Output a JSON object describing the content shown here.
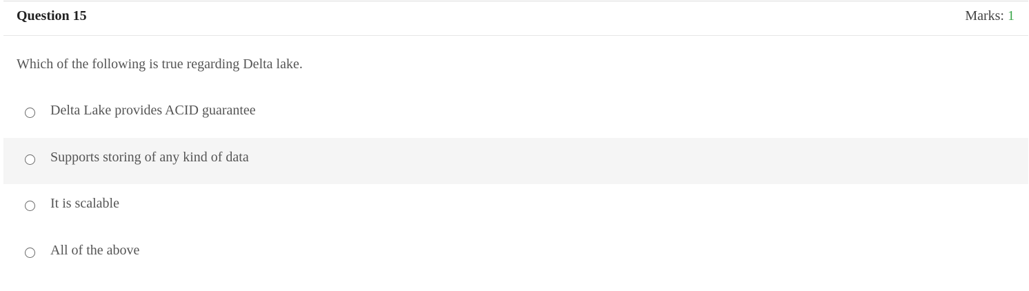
{
  "question": {
    "title": "Question 15",
    "marks_label": "Marks: ",
    "marks_value": "1",
    "text": "Which of the following is true regarding Delta lake."
  },
  "options": [
    {
      "label": "Delta Lake provides ACID guarantee"
    },
    {
      "label": "Supports storing of any kind of data"
    },
    {
      "label": "It is scalable"
    },
    {
      "label": "All of the above"
    }
  ],
  "colors": {
    "marks_value": "#3aa64a",
    "highlight_row": "#f5f5f5"
  }
}
